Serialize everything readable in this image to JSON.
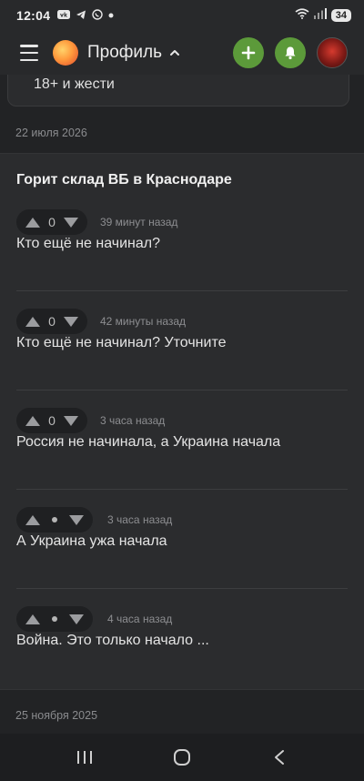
{
  "status_bar": {
    "time": "12:04",
    "app_icons": [
      "vk-icon",
      "telegram-icon",
      "whatsapp-icon",
      "dot-icon"
    ],
    "battery": "34"
  },
  "header": {
    "title": "Профиль",
    "accent_color": "#5c9a3a"
  },
  "feed": {
    "previous_card_text": "18+ и жести",
    "date_1": "22 июля 2026",
    "post": {
      "title": "Горит склад ВБ в Краснодаре",
      "comments": [
        {
          "score": "0",
          "time": "39 минут назад",
          "text": "Кто ещё не начинал?"
        },
        {
          "score": "0",
          "time": "42 минуты назад",
          "text": "Кто ещё не начинал? Уточните"
        },
        {
          "score": "0",
          "time": "3 часа назад",
          "text": "Россия не начинала, а Украина начала"
        },
        {
          "score": "•",
          "time": "3 часа назад",
          "text": "А Украина ужа начала"
        },
        {
          "score": "•",
          "time": "4 часа назад",
          "text": "Война. Это только начало ..."
        }
      ]
    },
    "date_2": "25 ноября 2025"
  }
}
